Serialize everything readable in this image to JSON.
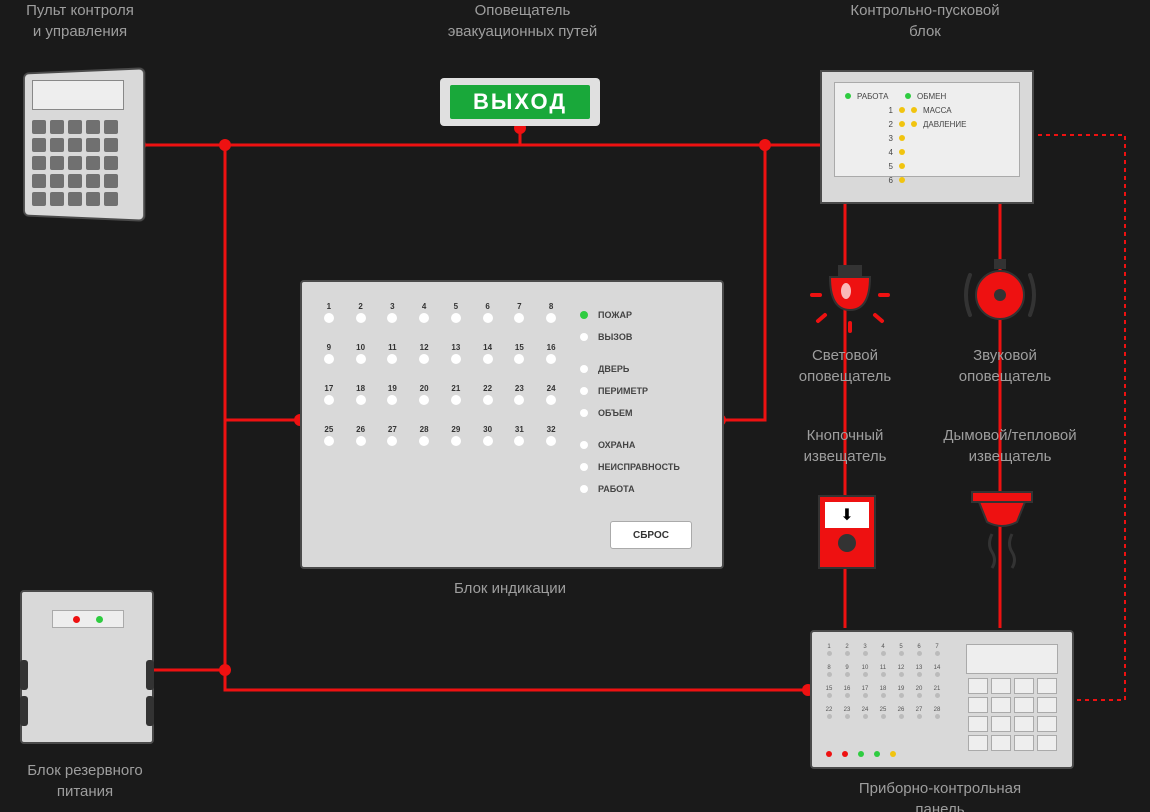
{
  "labels": {
    "keypad": "Пульт контроля\nи управления",
    "exit_sign": "Оповещатель\nэвакуационных путей",
    "ctrl_block": "Контрольно-пусковой\nблок",
    "indication": "Блок индикации",
    "backup_power": "Блок резервного\nпитания",
    "light_notifier": "Световой\nоповещатель",
    "sound_notifier": "Звуковой\nоповещатель",
    "button_detector": "Кнопочный\nизвещатель",
    "smoke_detector": "Дымовой/тепловой\nизвещатель",
    "control_panel": "Приборно-контрольная\nпанель"
  },
  "exit_text": "ВЫХОД",
  "ctrl_block_leds": {
    "left_header": "РАБОТА",
    "left_items": [
      "1",
      "2",
      "3",
      "4",
      "5",
      "6"
    ],
    "right_items": [
      "ОБМЕН",
      "МАССА",
      "ДАВЛЕНИЕ"
    ]
  },
  "indication_block": {
    "zones": [
      "1",
      "2",
      "3",
      "4",
      "5",
      "6",
      "7",
      "8",
      "9",
      "10",
      "11",
      "12",
      "13",
      "14",
      "15",
      "16",
      "17",
      "18",
      "19",
      "20",
      "21",
      "22",
      "23",
      "24",
      "25",
      "26",
      "27",
      "28",
      "29",
      "30",
      "31",
      "32"
    ],
    "statuses": [
      {
        "label": "ПОЖАР",
        "color": "gr"
      },
      {
        "label": "ВЫЗОВ",
        "color": ""
      },
      {
        "label": "ДВЕРЬ",
        "color": ""
      },
      {
        "label": "ПЕРИМЕТР",
        "color": ""
      },
      {
        "label": "ОБЪЕМ",
        "color": ""
      },
      {
        "label": "ОХРАНА",
        "color": ""
      },
      {
        "label": "НЕИСПРАВНОСТЬ",
        "color": ""
      },
      {
        "label": "РАБОТА",
        "color": ""
      }
    ],
    "reset_label": "СБРОС"
  },
  "control_panel": {
    "zones": [
      "1",
      "2",
      "3",
      "4",
      "5",
      "6",
      "7",
      "8",
      "9",
      "10",
      "11",
      "12",
      "13",
      "14",
      "15",
      "16",
      "17",
      "18",
      "19",
      "20",
      "21",
      "22",
      "23",
      "24",
      "25",
      "26",
      "27",
      "28"
    ]
  }
}
